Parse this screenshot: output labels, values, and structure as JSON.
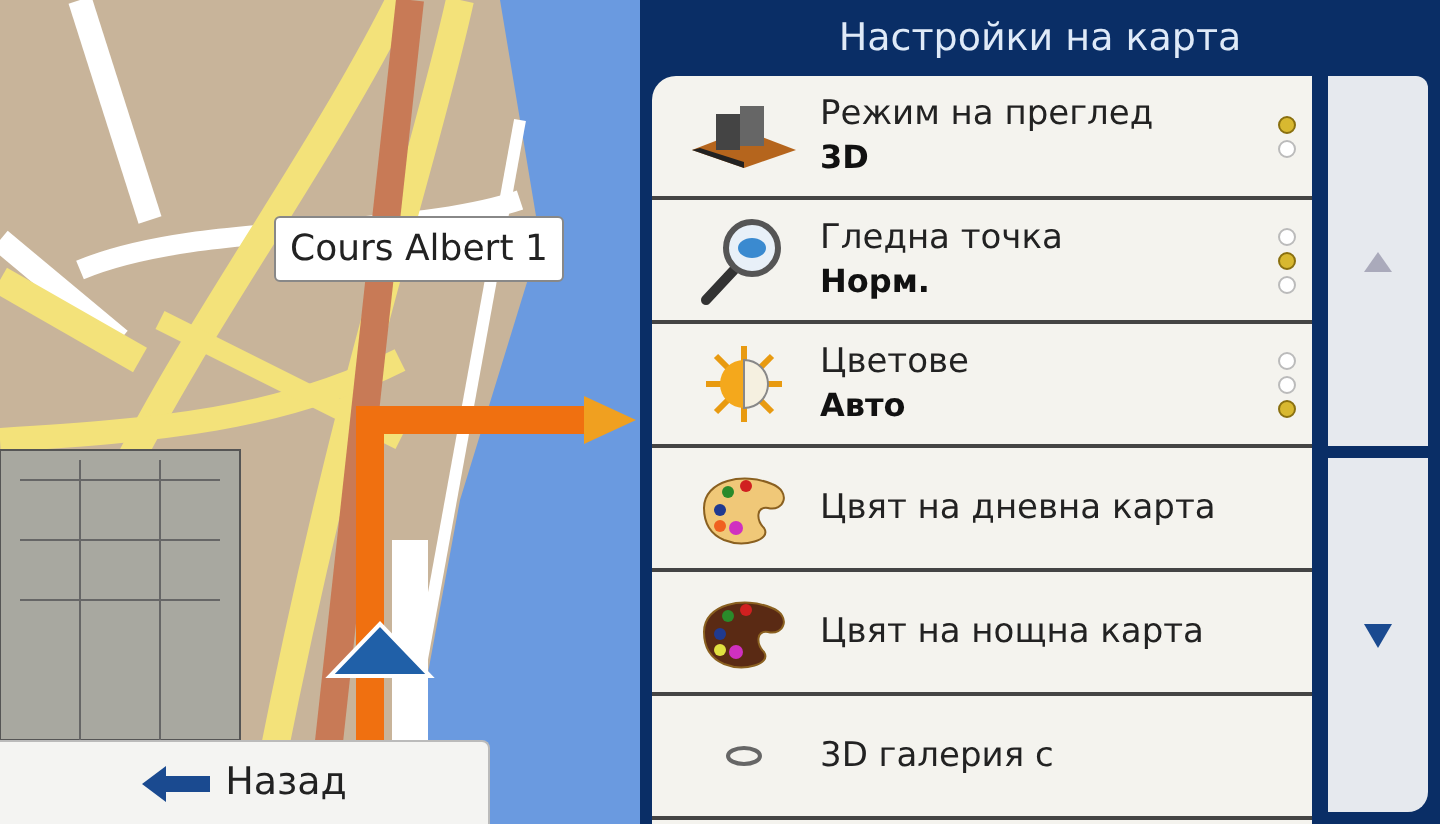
{
  "map": {
    "street_label": "Cours Albert 1"
  },
  "back_button": {
    "label": "Назад"
  },
  "panel": {
    "title": "Настройки на карта",
    "items": [
      {
        "kind": "view-mode",
        "title": "Режим на преглед",
        "value": "3D",
        "options": [
          {
            "selected": true
          },
          {
            "selected": false
          }
        ]
      },
      {
        "kind": "viewpoint",
        "title": "Гледна точка",
        "value": "Норм.",
        "options": [
          {
            "selected": false
          },
          {
            "selected": true
          },
          {
            "selected": false
          }
        ]
      },
      {
        "kind": "colors",
        "title": "Цветове",
        "value": "Авто",
        "options": [
          {
            "selected": false
          },
          {
            "selected": false
          },
          {
            "selected": true
          }
        ]
      },
      {
        "kind": "day-palette",
        "title": "Цвят на дневна карта"
      },
      {
        "kind": "night-palette",
        "title": "Цвят на нощна карта"
      },
      {
        "kind": "gallery",
        "title": "3D галерия с"
      }
    ]
  }
}
